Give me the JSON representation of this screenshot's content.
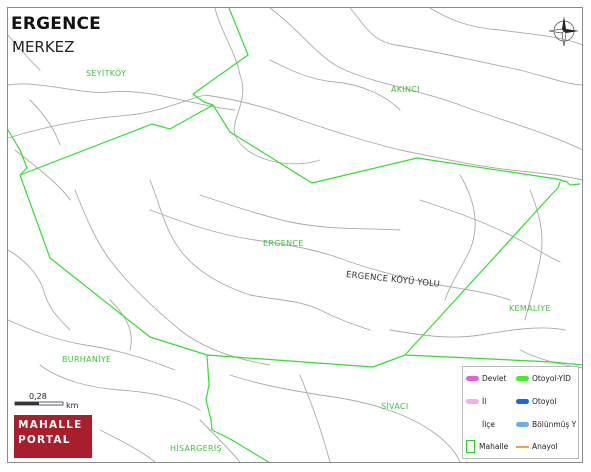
{
  "header": {
    "title": "ERGENCE",
    "subtitle": "MERKEZ"
  },
  "labels": {
    "seyitkoy": "SEYİTKÖY",
    "akinci": "AKINCI",
    "ergence": "ERGENCE",
    "kemaliye": "KEMALİYE",
    "burhaniye": "BURHANİYE",
    "sivaci": "SİVACI",
    "hisargeris": "HİSARGERİŞ"
  },
  "road_label": "ERGENCE KÖYÜ YOLU",
  "scale": {
    "value": "0,28",
    "unit": "km"
  },
  "logo": {
    "line1": "MAHALLE",
    "line2": "PORTAL"
  },
  "legend": {
    "devlet": "Devlet",
    "il": "İl",
    "ilce": "İlçe",
    "mahalle": "Mahalle",
    "otoyol_yid": "Otoyol-YİD",
    "otoyol": "Otoyol",
    "bolunmus": "Bölünmüş Y",
    "anayol": "Anayol"
  },
  "colors": {
    "boundary": "#33dd33",
    "label": "#3fc23f",
    "road": "#a8a8a8",
    "logo_bg": "#a81e2c",
    "devlet": "#e060e0",
    "il": "#f0b0e8",
    "otoyol_yid": "#44ee22",
    "otoyol": "#1a66e0",
    "bolunmus": "#6aaee8",
    "anayol": "#f0a040"
  },
  "icons": {
    "compass": "north-arrow-icon"
  }
}
